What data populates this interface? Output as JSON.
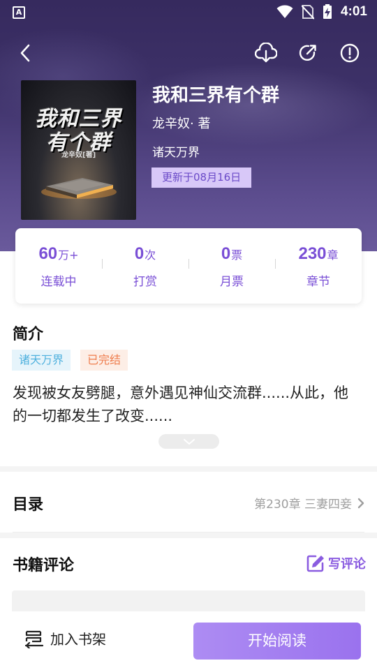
{
  "status_bar": {
    "time": "4:01",
    "app_letter": "A"
  },
  "toolbar": {
    "back_icon": "chevron-left-icon",
    "download_icon": "cloud-download-icon",
    "share_icon": "share-icon",
    "report_icon": "alert-circle-icon"
  },
  "book": {
    "title": "我和三界有个群",
    "author": "龙辛奴· 著",
    "genre": "诸天万界",
    "update": "更新于08月16日",
    "cover": {
      "line1": "我和三界",
      "line2": "有个群",
      "author": "龙辛奴[著]"
    }
  },
  "stats": [
    {
      "value": "60",
      "unit": "万+",
      "label": "连载中"
    },
    {
      "value": "0",
      "unit": "次",
      "label": "打赏"
    },
    {
      "value": "0",
      "unit": "票",
      "label": "月票"
    },
    {
      "value": "230",
      "unit": "章",
      "label": "章节"
    }
  ],
  "intro": {
    "title": "简介",
    "tags": [
      "诸天万界",
      "已完结"
    ],
    "text": "发现被女友劈腿，意外遇见神仙交流群......从此，他的一切都发生了改变......"
  },
  "catalog": {
    "title": "目录",
    "latest": "第230章 三妻四妾"
  },
  "comments": {
    "title": "书籍评论",
    "write_label": "写评论"
  },
  "bottom_bar": {
    "shelf_label": "加入书架",
    "read_label": "开始阅读"
  },
  "colors": {
    "accent": "#7a4fd6",
    "header": "#3d3168",
    "button": "#a07ff0"
  }
}
